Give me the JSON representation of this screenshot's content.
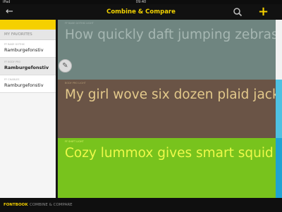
{
  "status_bar": {
    "carrier": "iPad",
    "time": "09:40",
    "right": ""
  },
  "nav": {
    "title": "Combine & Compare",
    "back_icon": "back-arrow-icon",
    "search_icon": "search-icon",
    "add_icon": "add-icon"
  },
  "sidebar": {
    "section_title": "MY FAVORITES",
    "items": [
      {
        "sub": "FF BASE GOTHIC",
        "name": "Ramburgefonstiv"
      },
      {
        "sub": "FF BODY PRO",
        "name": "Ramburgefonstiv"
      },
      {
        "sub": "FF CHARLES",
        "name": "Ramburgefonstiv"
      }
    ]
  },
  "samples": [
    {
      "label": "FF BASE GOTHIC LIGHT",
      "text": "How quickly daft jumping zebras vex! Two driven jocks"
    },
    {
      "label": "BODY PRO LIGHT",
      "text": "My girl wove six dozen plaid jackets before she quit. Fake bugs"
    },
    {
      "label": "FF SHIFT LIGHT",
      "text": "Cozy lummox gives smart squid who asks for job pen."
    }
  ],
  "tabs": [
    {
      "label": "FONTBOOK"
    },
    {
      "label": "COMBINE & COMPARE"
    }
  ],
  "colors": {
    "accent": "#f5d000",
    "sample_1_bg": "#6f8580",
    "sample_2_bg": "#6a5446",
    "sample_3_bg": "#78c31d"
  }
}
